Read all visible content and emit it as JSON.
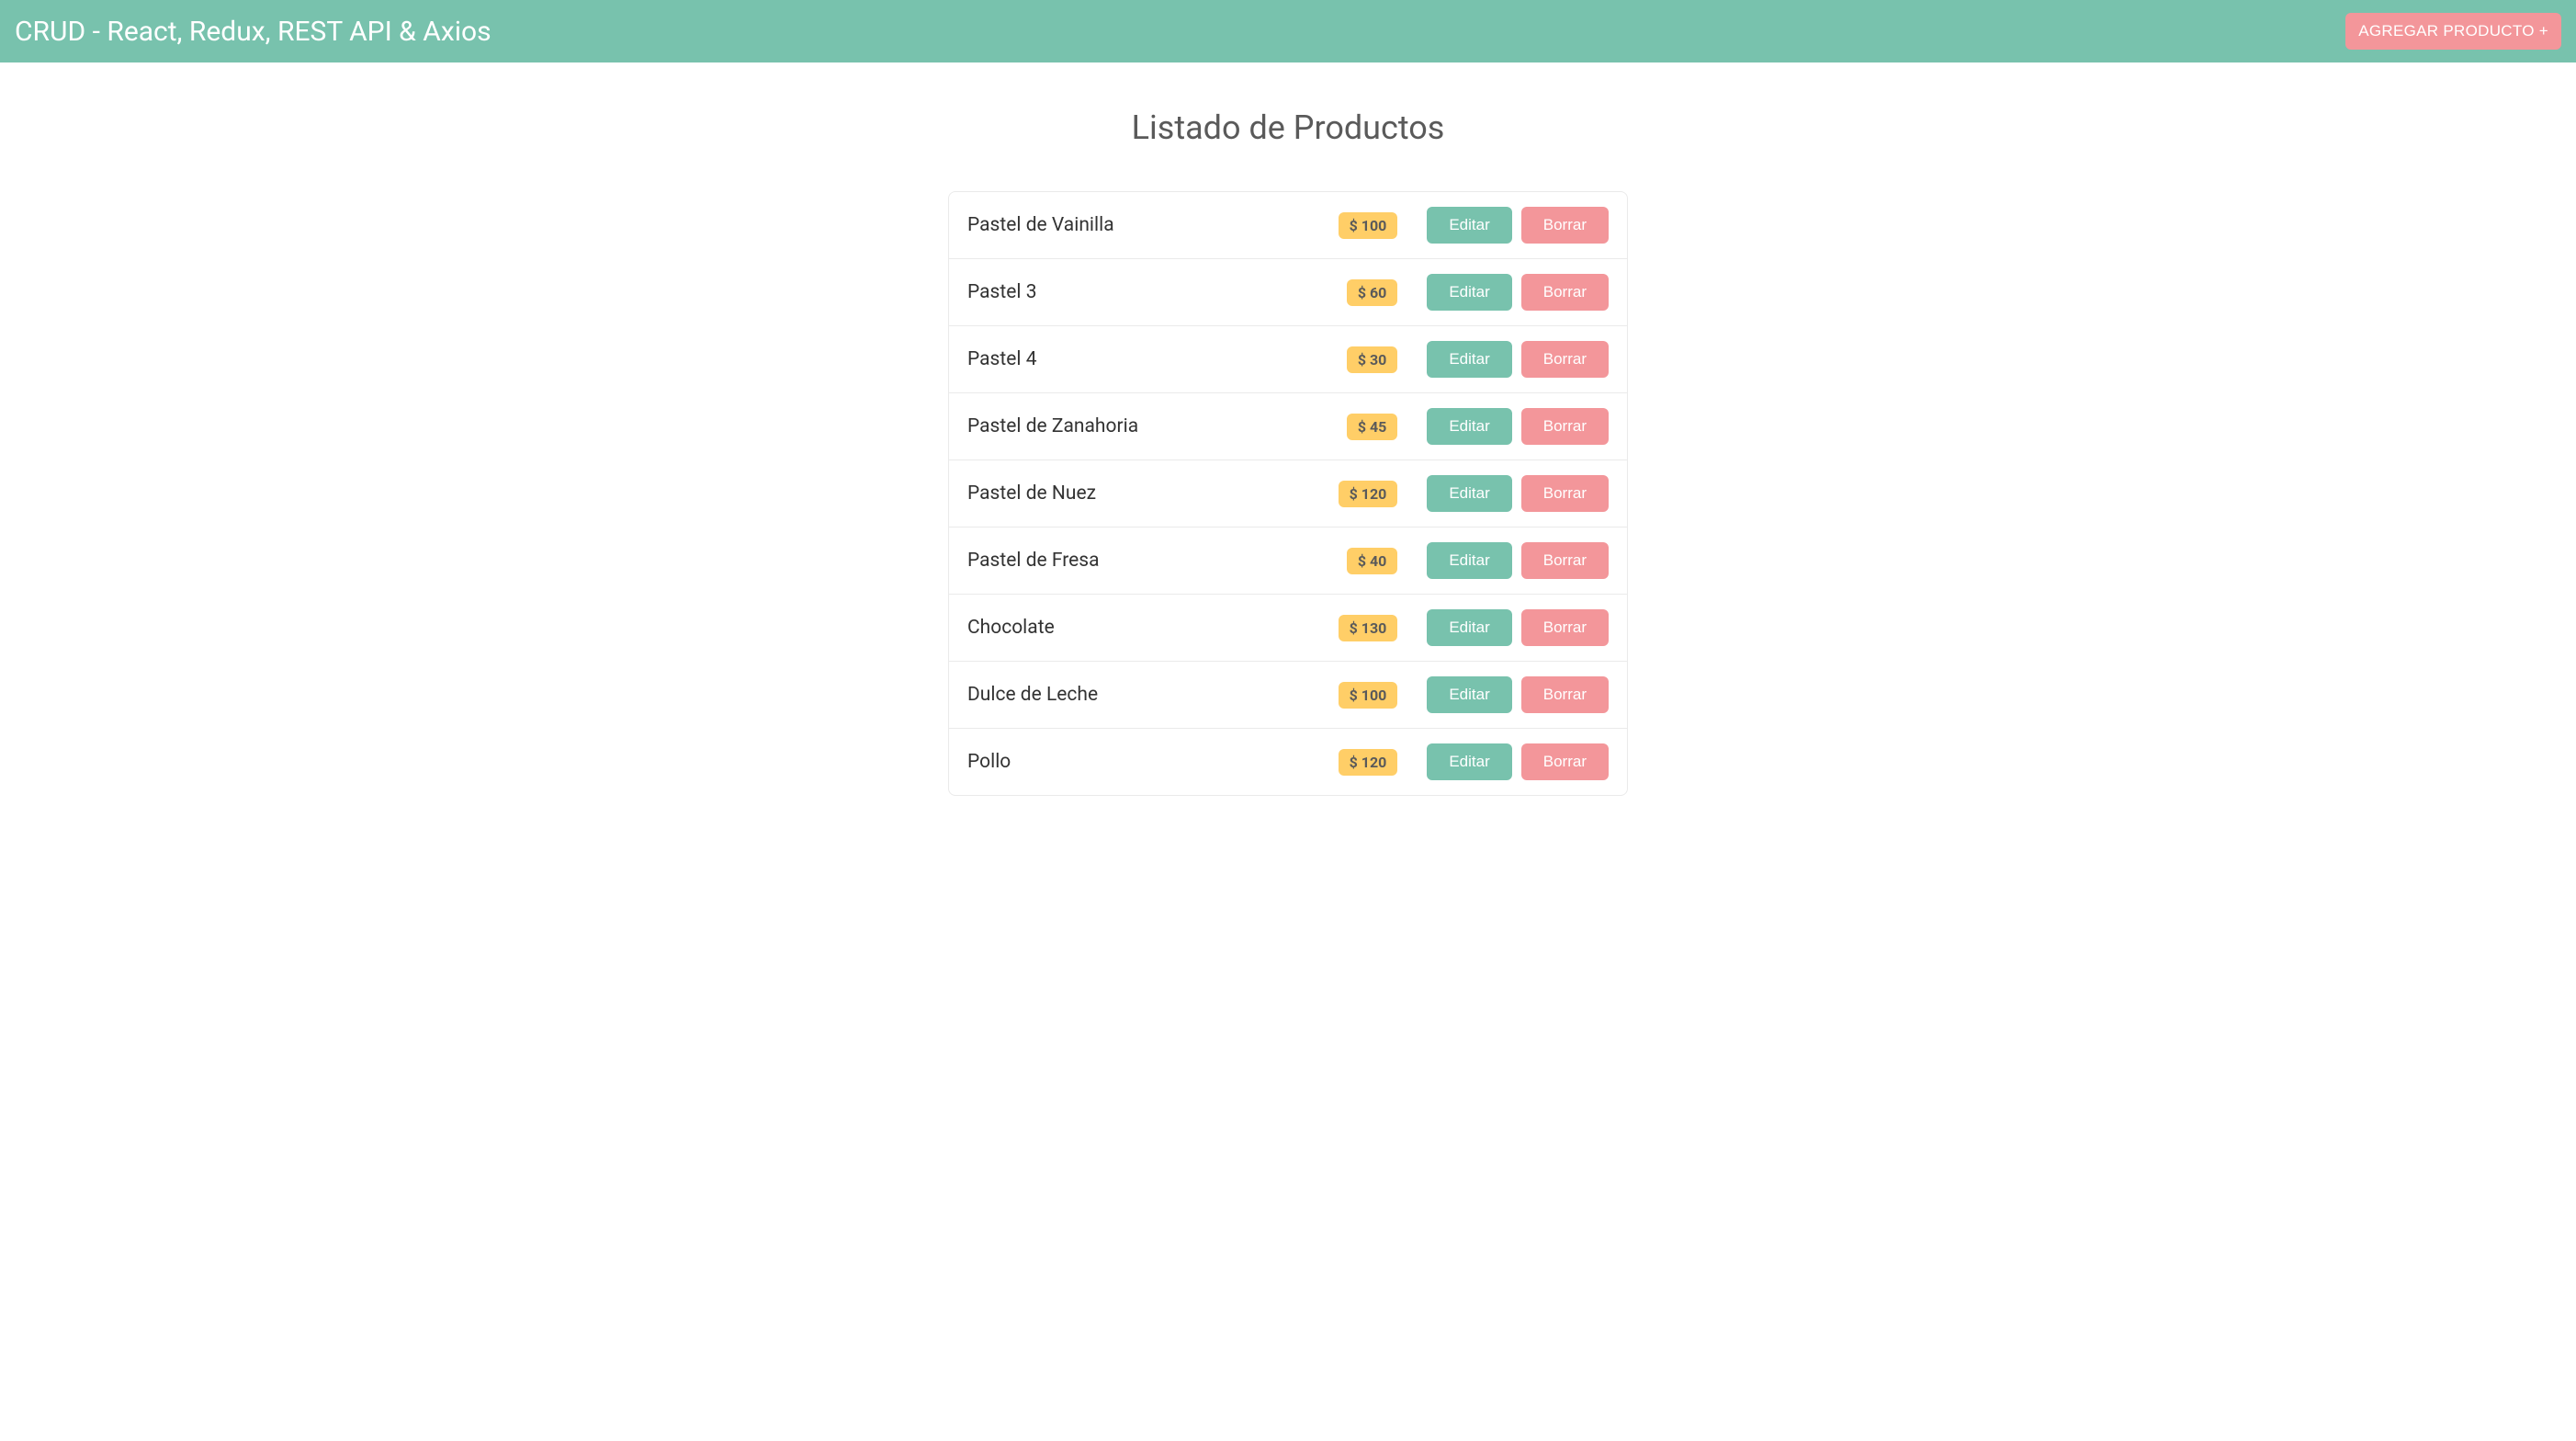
{
  "header": {
    "title": "CRUD - React, Redux, REST API & Axios",
    "add_button": "AGREGAR PRODUCTO +"
  },
  "page": {
    "title": "Listado de Productos"
  },
  "labels": {
    "edit": "Editar",
    "delete": "Borrar",
    "currency": "$"
  },
  "products": [
    {
      "name": "Pastel de Vainilla",
      "price": 100
    },
    {
      "name": "Pastel 3",
      "price": 60
    },
    {
      "name": "Pastel 4",
      "price": 30
    },
    {
      "name": "Pastel de Zanahoria",
      "price": 45
    },
    {
      "name": "Pastel de Nuez",
      "price": 120
    },
    {
      "name": "Pastel de Fresa",
      "price": 40
    },
    {
      "name": "Chocolate",
      "price": 130
    },
    {
      "name": "Dulce de Leche",
      "price": 100
    },
    {
      "name": "Pollo",
      "price": 120
    }
  ]
}
